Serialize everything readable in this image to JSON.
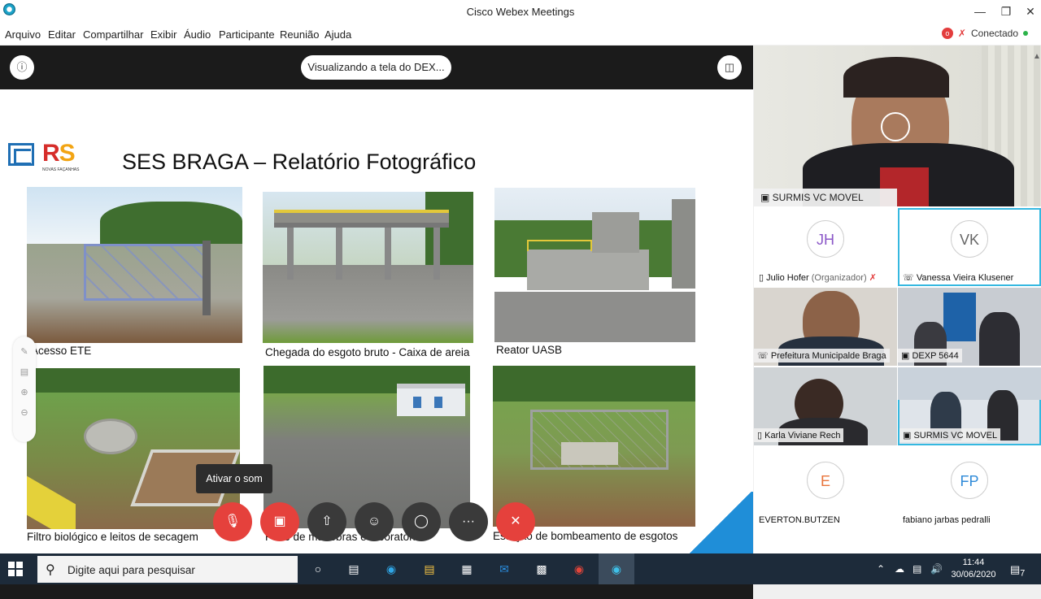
{
  "window": {
    "title": "Cisco Webex Meetings"
  },
  "menu": {
    "items": [
      "Arquivo",
      "Editar",
      "Compartilhar",
      "Exibir",
      "Áudio",
      "Participante",
      "Reunião",
      "Ajuda"
    ],
    "status": "Conectado",
    "rec_badge": "o"
  },
  "share": {
    "viewing": "Visualizando a tela do DEX...",
    "slide_title": "SES BRAGA – Relatório Fotográfico",
    "logo_rs": "RS",
    "logo_rs_r": "R",
    "logo_rs_s": "S",
    "logo_sub": "NOVAS FAÇANHAS",
    "captions": [
      "Acesso ETE",
      "Chegada do esgoto bruto - Caixa de areia",
      "Reator UASB",
      "Filtro biológico e leitos de secagem",
      "Pátio de manobras e laboratório",
      "Estação de bombeamento de esgotos"
    ],
    "tooltip": "Ativar o som"
  },
  "participants": {
    "main": "SURMIS VC MOVEL",
    "tiles": [
      {
        "initials": "JH",
        "name": "Julio Hofer",
        "role": "(Organizador)"
      },
      {
        "initials": "VK",
        "name": "Vanessa Vieira Klusener"
      },
      {
        "name": "Prefeitura Municipalde Braga"
      },
      {
        "name": "DEXP 5644"
      },
      {
        "name": "Karla Viviane Rech"
      },
      {
        "name": "SURMIS VC MOVEL"
      },
      {
        "initials": "E",
        "name": "EVERTON.BUTZEN"
      },
      {
        "initials": "FP",
        "name": "fabiano jarbas pedralli"
      }
    ]
  },
  "taskbar": {
    "search_placeholder": "Digite aqui para pesquisar",
    "time": "11:44",
    "date": "30/06/2020",
    "notif_count": "7"
  },
  "colors": {
    "accent": "#35b8e0",
    "danger": "#e5413c",
    "taskbar": "#1d2b3a"
  }
}
